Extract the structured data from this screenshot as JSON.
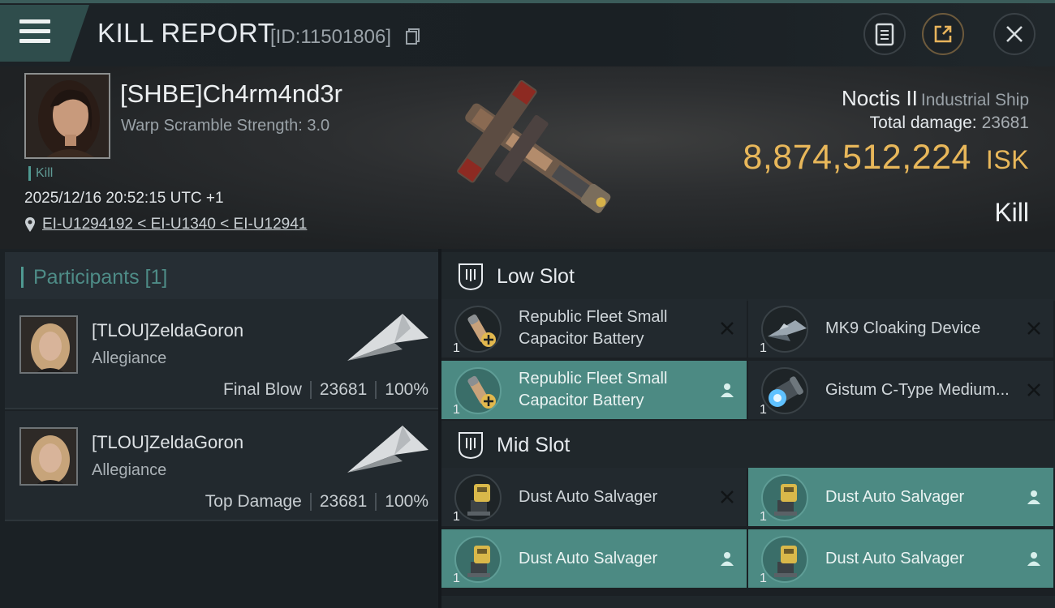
{
  "header": {
    "title": "KILL REPORT",
    "report_id": "[ID:11501806]",
    "icons": {
      "menu": "menu-icon",
      "copy": "copy-icon",
      "clipboard": "clipboard-icon",
      "share": "share-icon",
      "close": "close-icon"
    }
  },
  "victim": {
    "name": "[SHBE]Ch4rm4nd3r",
    "warp_scramble": "Warp Scramble Strength: 3.0",
    "kill_tag": "Kill",
    "datetime": "2025/12/16 20:52:15 UTC +1",
    "location": "EI-U1294192 < EI-U1340 < EI-U12941"
  },
  "ship": {
    "name": "Noctis II",
    "class": "Industrial Ship",
    "total_damage_label": "Total damage:",
    "total_damage_value": "23681",
    "isk_value": "8,874,512,224",
    "isk_unit": "ISK",
    "result": "Kill"
  },
  "participants": {
    "header": "Participants [1]",
    "items": [
      {
        "name": "[TLOU]ZeldaGoron",
        "corp": "Allegiance",
        "role": "Final Blow",
        "damage": "23681",
        "percent": "100%"
      },
      {
        "name": "[TLOU]ZeldaGoron",
        "corp": "Allegiance",
        "role": "Top Damage",
        "damage": "23681",
        "percent": "100%"
      }
    ]
  },
  "fittings": {
    "low_slot": {
      "title": "Low Slot",
      "items": [
        {
          "name": "Republic Fleet Small Capacitor Battery",
          "qty": "1",
          "status": "destroyed"
        },
        {
          "name": "MK9 Cloaking Device",
          "qty": "1",
          "status": "destroyed"
        },
        {
          "name": "Republic Fleet Small Capacitor Battery",
          "qty": "1",
          "status": "dropped"
        },
        {
          "name": "Gistum C-Type Medium...",
          "qty": "1",
          "status": "destroyed"
        }
      ]
    },
    "mid_slot": {
      "title": "Mid Slot",
      "items": [
        {
          "name": "Dust Auto Salvager",
          "qty": "1",
          "status": "destroyed"
        },
        {
          "name": "Dust Auto Salvager",
          "qty": "1",
          "status": "dropped"
        },
        {
          "name": "Dust Auto Salvager",
          "qty": "1",
          "status": "dropped"
        },
        {
          "name": "Dust Auto Salvager",
          "qty": "1",
          "status": "dropped"
        }
      ]
    }
  },
  "colors": {
    "accent": "#4c8a83",
    "isk": "#e8b75a",
    "muted_teal": "#4e8c87"
  }
}
